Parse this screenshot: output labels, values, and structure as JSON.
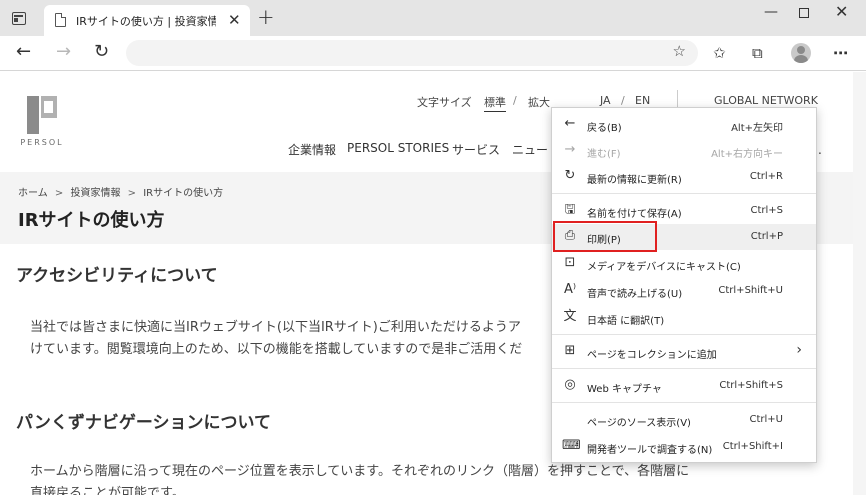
{
  "tab": {
    "title": "IRサイトの使い方 | 投資家情報 | PER",
    "close": "✕"
  },
  "toolbar": {
    "new_tab": "+",
    "minimize": "—",
    "close": "✕",
    "back": "←",
    "forward": "→",
    "refresh": "↻",
    "more": "⋯",
    "favorite": "☆",
    "favorites": "✩",
    "collections": "⧉"
  },
  "logo": {
    "text": "PERSOL"
  },
  "utility": {
    "text_size": "文字サイズ",
    "standard": "標準",
    "sep": "/",
    "large": "拡大",
    "ja": "JA",
    "en": "EN",
    "global": "GLOBAL NETWORK"
  },
  "nav": {
    "items": [
      "企業情報",
      "PERSOL STORIES",
      "サービス",
      "ニュー"
    ],
    "trailing": "."
  },
  "breadcrumb": {
    "items": [
      "ホーム",
      "投資家情報",
      "IRサイトの使い方"
    ],
    "sep": ">"
  },
  "page": {
    "title": "IRサイトの使い方",
    "section1_heading": "アクセシビリティについて",
    "section1_line1": "当社では皆さまに快適に当IRウェブサイト(以下当IRサイト)ご利用いただけるようア",
    "section1_line2": "けています。閲覧環境向上のため、以下の機能を搭載していますので是非ご活用くだ",
    "section2_heading": "パンくずナビゲーションについて",
    "section2_line1": "ホームから階層に沿って現在のページ位置を表示しています。それぞれのリンク（階層）を押すことで、各階層に",
    "section2_line2": "直接戻ることが可能です。"
  },
  "menu": {
    "items": [
      {
        "icon": "←",
        "label": "戻る(B)",
        "shortcut": "Alt+左矢印"
      },
      {
        "icon": "→",
        "label": "進む(F)",
        "shortcut": "Alt+右方向キー"
      },
      {
        "icon": "↻",
        "label": "最新の情報に更新(R)",
        "shortcut": "Ctrl+R"
      },
      {
        "icon": "🖫",
        "label": "名前を付けて保存(A)",
        "shortcut": "Ctrl+S"
      },
      {
        "icon": "⎙",
        "label": "印刷(P)",
        "shortcut": "Ctrl+P"
      },
      {
        "icon": "⊡",
        "label": "メディアをデバイスにキャスト(C)",
        "shortcut": ""
      },
      {
        "icon": "A⁾",
        "label": "音声で読み上げる(U)",
        "shortcut": "Ctrl+Shift+U"
      },
      {
        "icon": "文",
        "label": "日本語 に翻訳(T)",
        "shortcut": ""
      },
      {
        "icon": "⊞",
        "label": "ページをコレクションに追加",
        "shortcut": "",
        "arrow": "›"
      },
      {
        "icon": "◎",
        "label": "Web キャプチャ",
        "shortcut": "Ctrl+Shift+S"
      },
      {
        "icon": "",
        "label": "ページのソース表示(V)",
        "shortcut": "Ctrl+U"
      },
      {
        "icon": "⌨",
        "label": "開発者ツールで調査する(N)",
        "shortcut": "Ctrl+Shift+I"
      }
    ]
  }
}
